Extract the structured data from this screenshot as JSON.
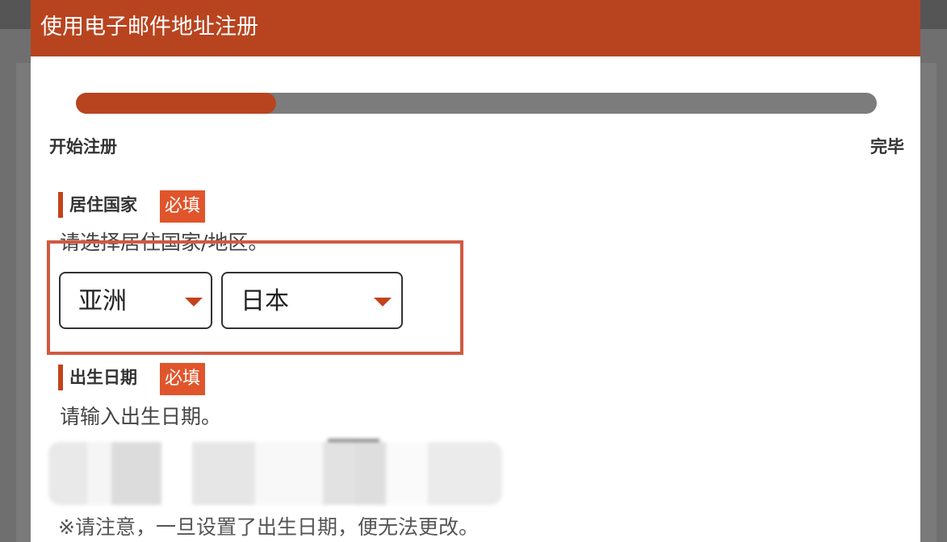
{
  "modal": {
    "title": "使用电子邮件地址注册"
  },
  "progress": {
    "value": 0.25,
    "start_label": "开始注册",
    "end_label": "完毕"
  },
  "residence": {
    "label": "居住国家",
    "required_badge": "必填",
    "hint": "请选择居住国家/地区。",
    "region_select": {
      "value": "亚洲"
    },
    "country_select": {
      "value": "日本"
    }
  },
  "birthdate": {
    "label": "出生日期",
    "required_badge": "必填",
    "hint": "请输入出生日期。",
    "note": "※请注意，一旦设置了出生日期，便无法更改。"
  },
  "colors": {
    "accent": "#b8441f",
    "badge": "#e0552b",
    "highlight": "#d05a42",
    "track": "#7c7c7c"
  }
}
